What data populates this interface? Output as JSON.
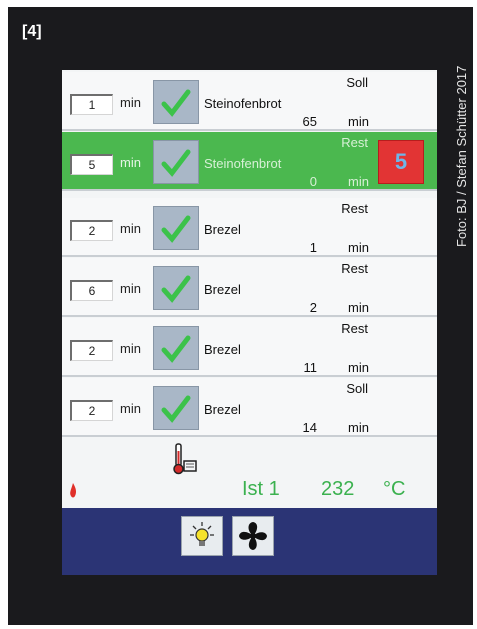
{
  "figure_label": "[4]",
  "photo_credit": "Foto: BJ / Stefan Schütter 2017",
  "rows": [
    {
      "time_value": "1",
      "time_unit": "min",
      "product": "Steinofenbrot",
      "state": "Soll",
      "value": "65",
      "value_unit": "min",
      "active": false
    },
    {
      "time_value": "5",
      "time_unit": "min",
      "product": "Steinofenbrot",
      "state": "Rest",
      "value": "0",
      "value_unit": "min",
      "active": true,
      "badge": "5"
    },
    {
      "time_value": "2",
      "time_unit": "min",
      "product": "Brezel",
      "state": "Rest",
      "value": "1",
      "value_unit": "min",
      "active": false
    },
    {
      "time_value": "6",
      "time_unit": "min",
      "product": "Brezel",
      "state": "Rest",
      "value": "2",
      "value_unit": "min",
      "active": false
    },
    {
      "time_value": "2",
      "time_unit": "min",
      "product": "Brezel",
      "state": "Rest",
      "value": "11",
      "value_unit": "min",
      "active": false
    },
    {
      "time_value": "2",
      "time_unit": "min",
      "product": "Brezel",
      "state": "Soll",
      "value": "14",
      "value_unit": "min",
      "active": false
    }
  ],
  "status": {
    "label": "Ist 1",
    "temperature": "232",
    "unit": "°C"
  },
  "colors": {
    "active_row": "#4bb84f",
    "bottom_bar": "#2b3475",
    "status_text": "#3bb14f",
    "badge": "#e23434"
  },
  "icons": [
    "check-icon",
    "thermometer-icon",
    "flame-icon",
    "light-icon",
    "fan-icon"
  ]
}
